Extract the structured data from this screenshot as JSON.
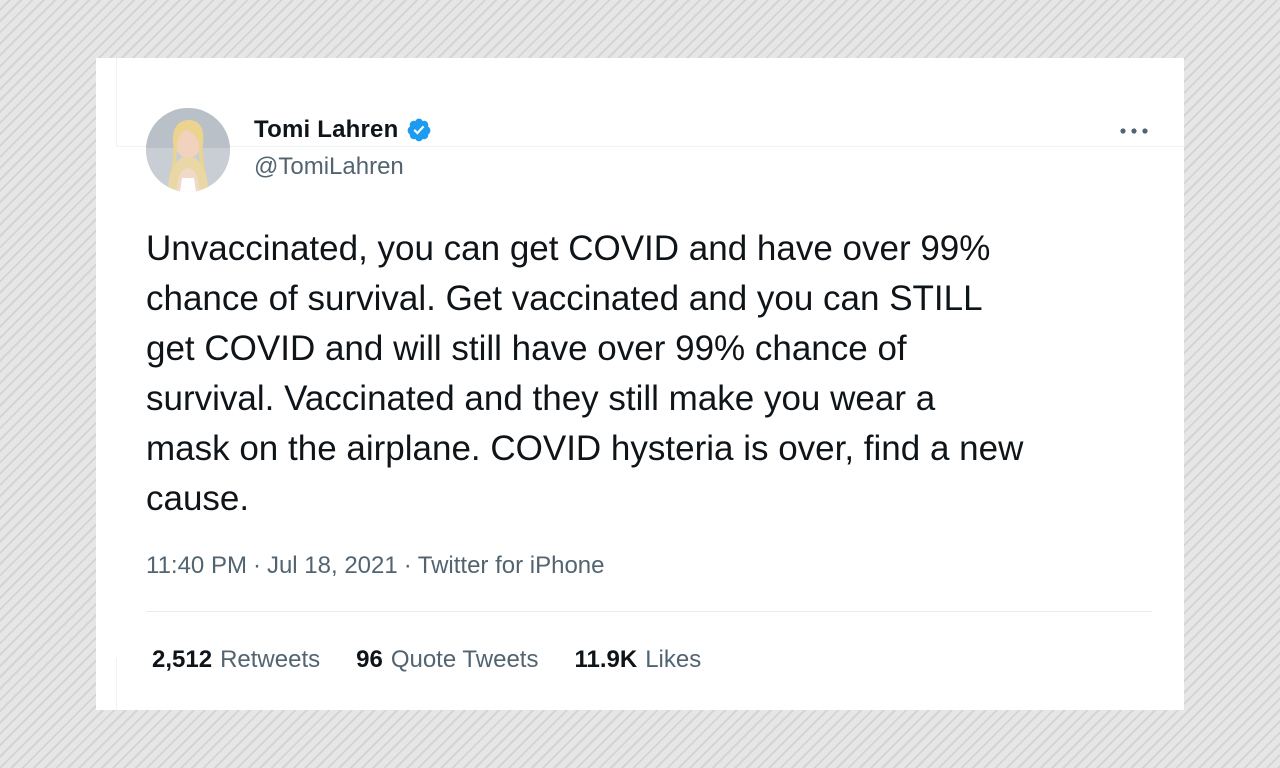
{
  "tweet": {
    "author": {
      "display_name": "Tomi Lahren",
      "handle": "@TomiLahren",
      "verified": true,
      "avatar_icon": "profile-photo"
    },
    "text": "Unvaccinated, you can get COVID and have over 99%\nchance of survival. Get vaccinated and you can STILL\nget COVID and will still have over 99% chance of\nsurvival. Vaccinated and they still make you wear a\nmask on the airplane. COVID hysteria is over, find a new\ncause.",
    "time": "11:40 PM",
    "separator": "·",
    "date": "Jul 18, 2021",
    "source": "Twitter for iPhone",
    "stats": [
      {
        "count": "2,512",
        "label": "Retweets"
      },
      {
        "count": "96",
        "label": "Quote Tweets"
      },
      {
        "count": "11.9K",
        "label": "Likes"
      }
    ],
    "more_icon": "more-horizontal-icon"
  },
  "colors": {
    "verified_blue": "#1d9bf0",
    "text_primary": "#0f1419",
    "text_secondary": "#536471",
    "divider": "#e6ecf0"
  }
}
